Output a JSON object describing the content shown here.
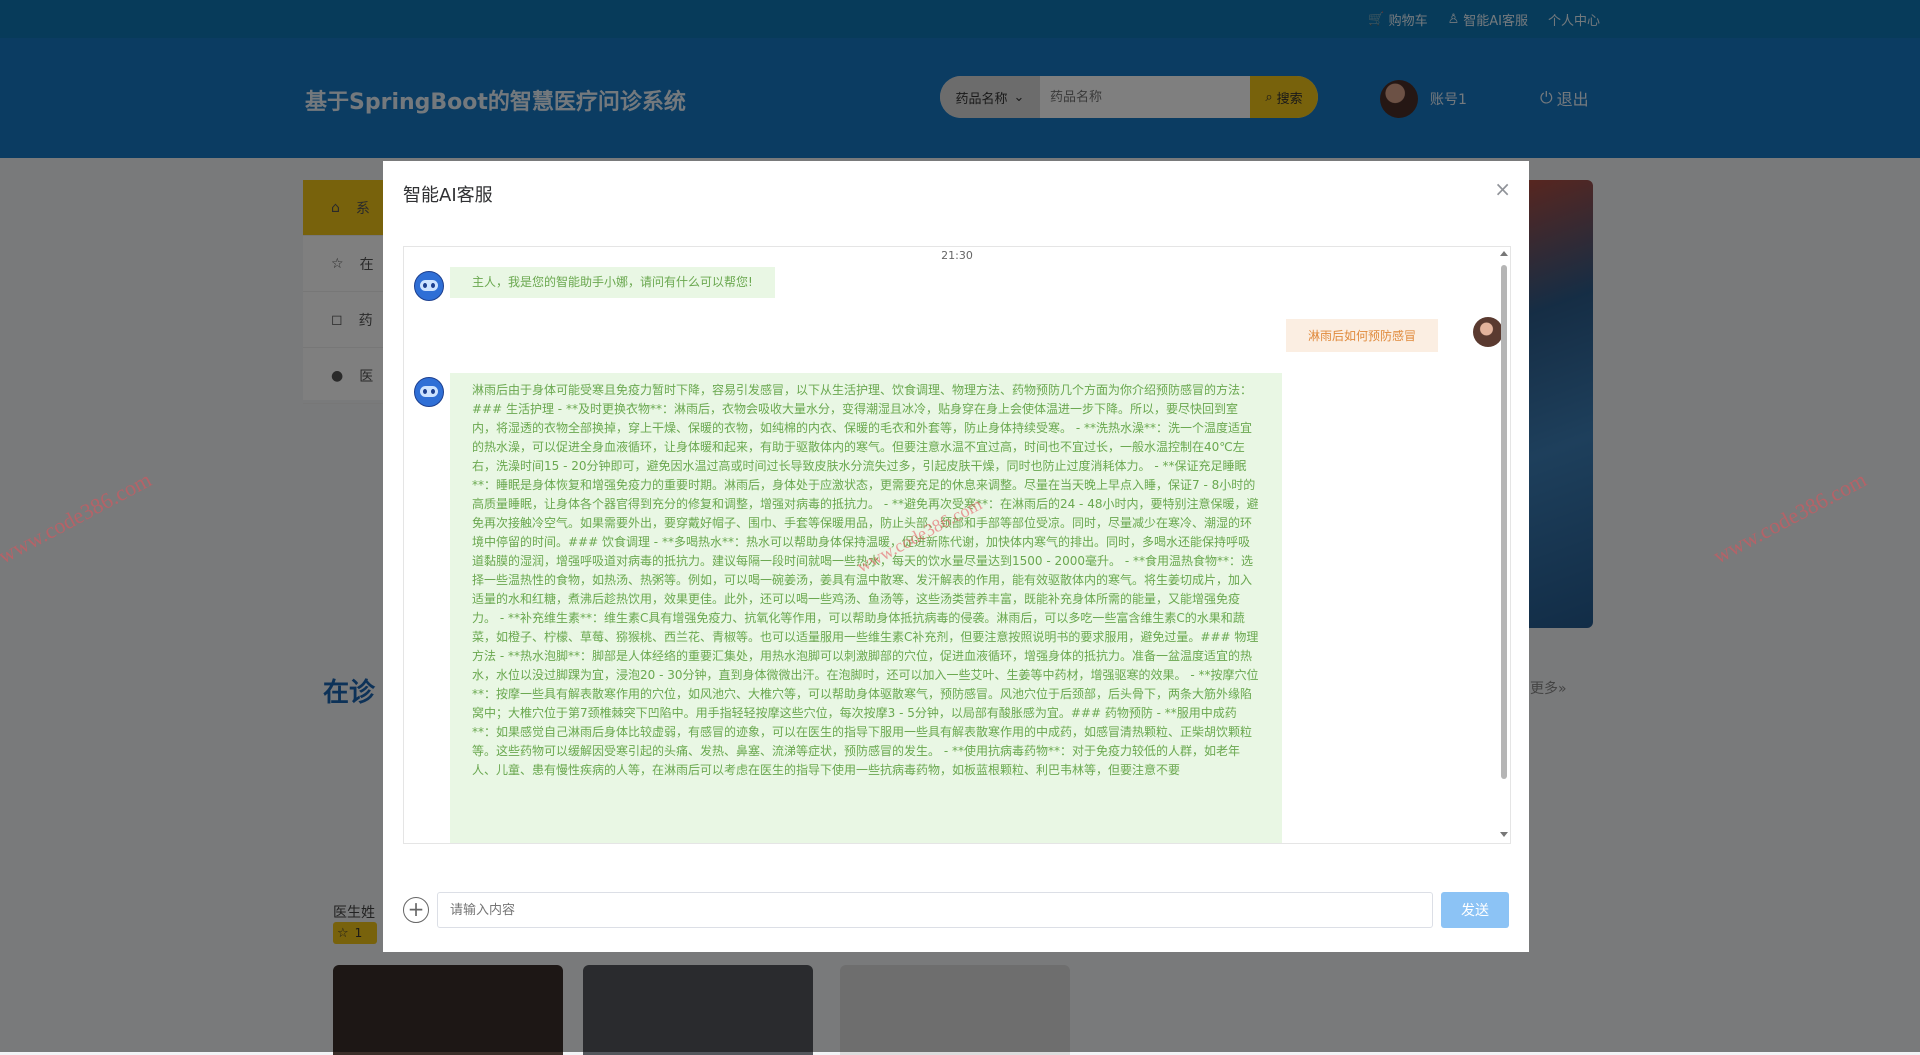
{
  "topbar": {
    "cart": "购物车",
    "ai_service": "智能AI客服",
    "user_center": "个人中心"
  },
  "header": {
    "title": "基于SpringBoot的智慧医疗问诊系统",
    "search_select": "药品名称",
    "search_placeholder": "药品名称",
    "search_button": "搜索",
    "username": "账号1",
    "logout": "退出"
  },
  "sidebar": {
    "items": [
      "系",
      "在",
      "药",
      "医"
    ]
  },
  "section": {
    "title": "在诊",
    "more": "更多»",
    "doctor_label": "医生姓",
    "rating": "1"
  },
  "modal": {
    "title": "智能AI客服",
    "time": "21:30",
    "messages": [
      {
        "from": "bot",
        "text": "主人，我是您的智能助手小娜，请问有什么可以帮您!"
      },
      {
        "from": "user",
        "text": "淋雨后如何预防感冒"
      },
      {
        "from": "bot",
        "text": "淋雨后由于身体可能受寒且免疫力暂时下降，容易引发感冒，以下从生活护理、饮食调理、物理方法、药物预防几个方面为你介绍预防感冒的方法：### 生活护理 - **及时更换衣物**：淋雨后，衣物会吸收大量水分，变得潮湿且冰冷，贴身穿在身上会使体温进一步下降。所以，要尽快回到室内，将湿透的衣物全部换掉，穿上干燥、保暖的衣物，如纯棉的内衣、保暖的毛衣和外套等，防止身体持续受寒。 - **洗热水澡**：洗一个温度适宜的热水澡，可以促进全身血液循环，让身体暖和起来，有助于驱散体内的寒气。但要注意水温不宜过高，时间也不宜过长，一般水温控制在40℃左右，洗澡时间15 - 20分钟即可，避免因水温过高或时间过长导致皮肤水分流失过多，引起皮肤干燥，同时也防止过度消耗体力。 - **保证充足睡眠**：睡眠是身体恢复和增强免疫力的重要时期。淋雨后，身体处于应激状态，更需要充足的休息来调整。尽量在当天晚上早点入睡，保证7 - 8小时的高质量睡眠，让身体各个器官得到充分的修复和调整，增强对病毒的抵抗力。 - **避免再次受寒**：在淋雨后的24 - 48小时内，要特别注意保暖，避免再次接触冷空气。如果需要外出，要穿戴好帽子、围巾、手套等保暖用品，防止头部、颈部和手部等部位受凉。同时，尽量减少在寒冷、潮湿的环境中停留的时间。### 饮食调理 - **多喝热水**：热水可以帮助身体保持温暖，促进新陈代谢，加快体内寒气的排出。同时，多喝水还能保持呼吸道黏膜的湿润，增强呼吸道对病毒的抵抗力。建议每隔一段时间就喝一些热水，每天的饮水量尽量达到1500 - 2000毫升。 - **食用温热食物**：选择一些温热性的食物，如热汤、热粥等。例如，可以喝一碗姜汤，姜具有温中散寒、发汗解表的作用，能有效驱散体内的寒气。将生姜切成片，加入适量的水和红糖，煮沸后趁热饮用，效果更佳。此外，还可以喝一些鸡汤、鱼汤等，这些汤类营养丰富，既能补充身体所需的能量，又能增强免疫力。 - **补充维生素**：维生素C具有增强免疫力、抗氧化等作用，可以帮助身体抵抗病毒的侵袭。淋雨后，可以多吃一些富含维生素C的水果和蔬菜，如橙子、柠檬、草莓、猕猴桃、西兰花、青椒等。也可以适量服用一些维生素C补充剂，但要注意按照说明书的要求服用，避免过量。### 物理方法 - **热水泡脚**：脚部是人体经络的重要汇集处，用热水泡脚可以刺激脚部的穴位，促进血液循环，增强身体的抵抗力。准备一盆温度适宜的热水，水位以没过脚踝为宜，浸泡20 - 30分钟，直到身体微微出汗。在泡脚时，还可以加入一些艾叶、生姜等中药材，增强驱寒的效果。 - **按摩穴位**：按摩一些具有解表散寒作用的穴位，如风池穴、大椎穴等，可以帮助身体驱散寒气，预防感冒。风池穴位于后颈部，后头骨下，两条大筋外缘陷窝中；大椎穴位于第7颈椎棘突下凹陷中。用手指轻轻按摩这些穴位，每次按摩3 - 5分钟，以局部有酸胀感为宜。### 药物预防 - **服用中成药**：如果感觉自己淋雨后身体比较虚弱，有感冒的迹象，可以在医生的指导下服用一些具有解表散寒作用的中成药，如感冒清热颗粒、正柴胡饮颗粒等。这些药物可以缓解因受寒引起的头痛、发热、鼻塞、流涕等症状，预防感冒的发生。 - **使用抗病毒药物**：对于免疫力较低的人群，如老年人、儿童、患有慢性疾病的人等，在淋雨后可以考虑在医生的指导下使用一些抗病毒药物，如板蓝根颗粒、利巴韦林等，但要注意不要"
      }
    ],
    "input_placeholder": "请输入内容",
    "send_button": "发送"
  },
  "watermark": "www.code386.com"
}
